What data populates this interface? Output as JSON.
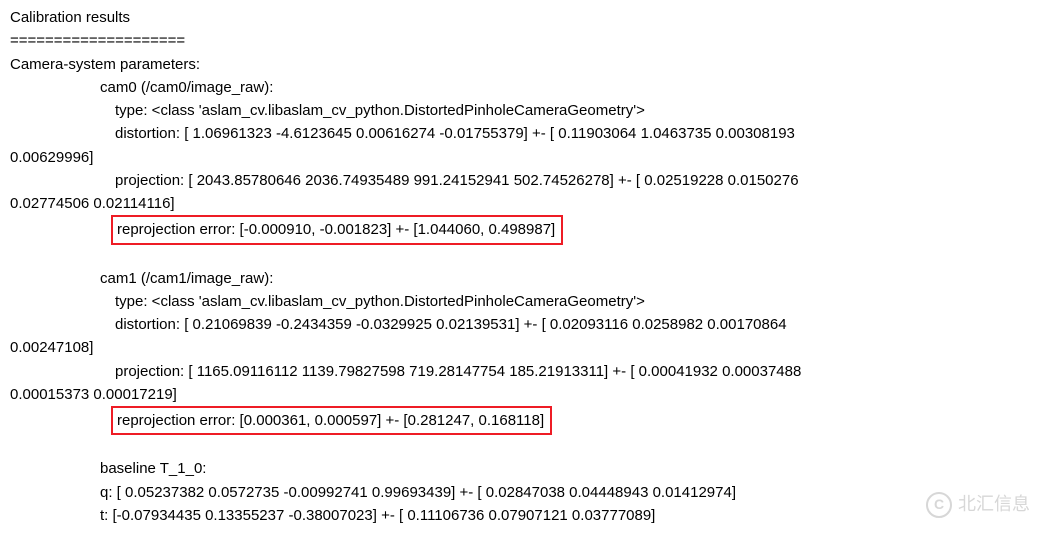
{
  "header": {
    "title": "Calibration results",
    "separator": "====================",
    "subtitle": "Camera-system parameters:"
  },
  "cam0": {
    "name_line": "cam0 (/cam0/image_raw):",
    "type_line": "type: <class 'aslam_cv.libaslam_cv_python.DistortedPinholeCameraGeometry'>",
    "distortion_line1": "distortion: [ 1.06961323 -4.6123645   0.00616274 -0.01755379] +- [ 0.11903064  1.0463735   0.00308193",
    "distortion_line2": "0.00629996]",
    "projection_line1": "projection: [ 2043.85780646  2036.74935489   991.24152941   502.74526278] +- [ 0.02519228  0.0150276",
    "projection_line2": "0.02774506  0.02114116]",
    "reprojection": "reprojection error: [-0.000910, -0.001823] +- [1.044060, 0.498987]"
  },
  "cam1": {
    "name_line": "cam1 (/cam1/image_raw):",
    "type_line": "type: <class 'aslam_cv.libaslam_cv_python.DistortedPinholeCameraGeometry'>",
    "distortion_line1": "distortion: [ 0.21069839 -0.2434359  -0.0329925   0.02139531] +- [ 0.02093116  0.0258982   0.00170864",
    "distortion_line2": "0.00247108]",
    "projection_line1": "projection: [ 1165.09116112  1139.79827598   719.28147754   185.21913311] +- [ 0.00041932  0.00037488",
    "projection_line2": "0.00015373  0.00017219]",
    "reprojection": "reprojection error: [0.000361, 0.000597] +- [0.281247, 0.168118]"
  },
  "baseline": {
    "title": "baseline T_1_0:",
    "q_line": "q: [ 0.05237382  0.0572735  -0.00992741  0.99693439] +- [ 0.02847038  0.04448943  0.01412974]",
    "t_line": "t: [-0.07934435  0.13355237 -0.38007023] +- [ 0.11106736  0.07907121  0.03777089]"
  },
  "watermark": {
    "text": "北汇信息"
  }
}
